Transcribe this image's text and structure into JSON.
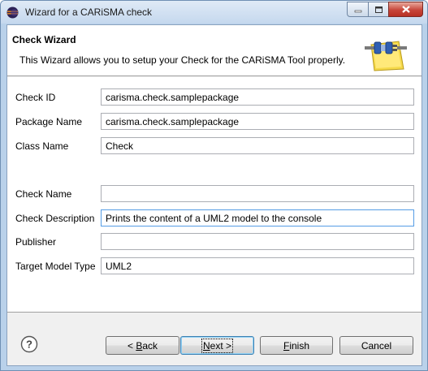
{
  "window": {
    "title": "Wizard for a CARiSMA check"
  },
  "header": {
    "title": "Check Wizard",
    "description": "This Wizard allows you to setup your Check for the CARiSMA Tool properly."
  },
  "form": {
    "check_id": {
      "label": "Check ID",
      "value": "carisma.check.samplepackage"
    },
    "package_name": {
      "label": "Package Name",
      "value": "carisma.check.samplepackage"
    },
    "class_name": {
      "label": "Class Name",
      "value": "Check"
    },
    "check_name": {
      "label": "Check Name",
      "value": ""
    },
    "check_description": {
      "label": "Check Description",
      "value": "Prints the content of a UML2 model to the console"
    },
    "publisher": {
      "label": "Publisher",
      "value": ""
    },
    "target_model_type": {
      "label": "Target Model Type",
      "value": "UML2"
    }
  },
  "buttons": {
    "back": {
      "label": "< Back",
      "mnemonic_prefix": "< ",
      "mnemonic": "B",
      "rest": "ack"
    },
    "next": {
      "label": "Next >",
      "mnemonic": "N",
      "rest": "ext >"
    },
    "finish": {
      "label": "Finish",
      "mnemonic": "F",
      "rest": "inish"
    },
    "cancel": {
      "label": "Cancel"
    }
  },
  "icons": {
    "app": "eclipse-icon",
    "help": "help-icon",
    "wizard": "wizard-plug-icon"
  }
}
